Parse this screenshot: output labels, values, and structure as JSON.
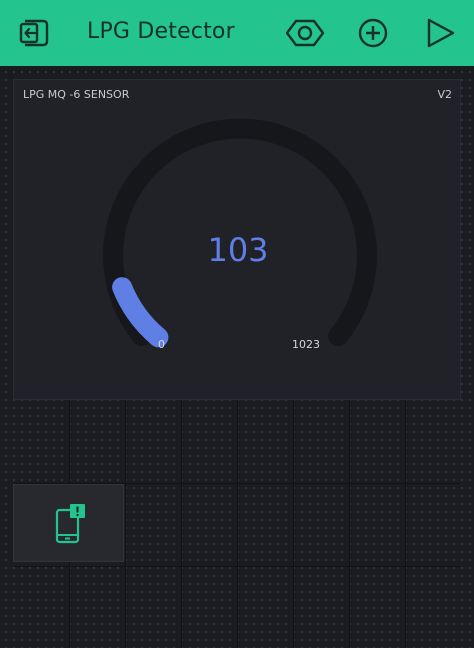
{
  "header": {
    "back_icon": "exit-app-icon",
    "title": "LPG Detector",
    "settings_icon": "hexagon-settings-icon",
    "add_icon": "plus-circle-icon",
    "play_icon": "play-icon",
    "accent_color": "#23c48e"
  },
  "gauge": {
    "label": "LPG MQ -6 SENSOR",
    "pin": "V2",
    "value": "103",
    "min": "0",
    "max": "1023",
    "value_color": "#5f7fe4",
    "track_color": "#16171b"
  },
  "notification_widget": {
    "icon": "phone-notification-icon",
    "icon_color": "#23c48e"
  }
}
